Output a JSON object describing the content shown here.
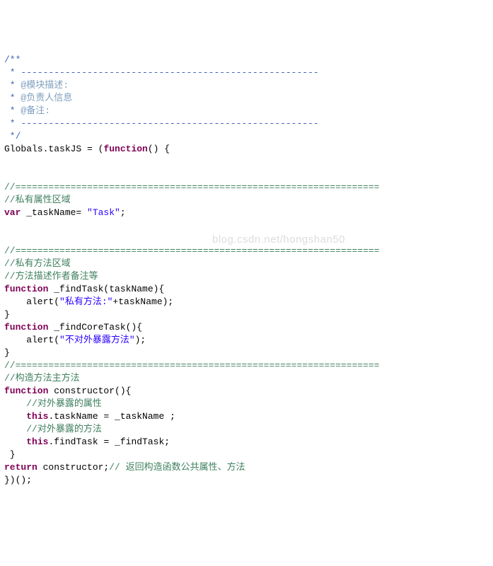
{
  "watermark": "blog.csdn.net/hongshan50",
  "lines": [
    {
      "segs": [
        {
          "t": "/**",
          "c": "c-doccomment"
        }
      ]
    },
    {
      "segs": [
        {
          "t": " * ",
          "c": "c-doccomment"
        },
        {
          "t": "------------------------------------------------------",
          "c": "c-doccomment"
        }
      ]
    },
    {
      "segs": [
        {
          "t": " * ",
          "c": "c-doccomment"
        },
        {
          "t": "@模块描述:",
          "c": "c-doctag"
        }
      ]
    },
    {
      "segs": [
        {
          "t": " * ",
          "c": "c-doccomment"
        },
        {
          "t": "@负责人信息",
          "c": "c-doctag"
        }
      ]
    },
    {
      "segs": [
        {
          "t": " * ",
          "c": "c-doccomment"
        },
        {
          "t": "@备注:",
          "c": "c-doctag"
        }
      ]
    },
    {
      "segs": [
        {
          "t": " * ",
          "c": "c-doccomment"
        },
        {
          "t": "------------------------------------------------------",
          "c": "c-doccomment"
        }
      ]
    },
    {
      "segs": [
        {
          "t": " */",
          "c": "c-doccomment"
        }
      ]
    },
    {
      "segs": [
        {
          "t": "Globals.taskJS = (",
          "c": "c-default"
        },
        {
          "t": "function",
          "c": "c-keyword"
        },
        {
          "t": "() {",
          "c": "c-default"
        }
      ]
    },
    {
      "segs": [
        {
          "t": "",
          "c": "c-default"
        }
      ]
    },
    {
      "segs": [
        {
          "t": "",
          "c": "c-default"
        }
      ]
    },
    {
      "segs": [
        {
          "t": "//==================================================================",
          "c": "c-comment"
        }
      ]
    },
    {
      "segs": [
        {
          "t": "//私有属性区域",
          "c": "c-comment"
        }
      ]
    },
    {
      "segs": [
        {
          "t": "var",
          "c": "c-keyword"
        },
        {
          "t": " _taskName= ",
          "c": "c-default"
        },
        {
          "t": "\"Task\"",
          "c": "c-string"
        },
        {
          "t": ";",
          "c": "c-default"
        }
      ]
    },
    {
      "segs": [
        {
          "t": "",
          "c": "c-default"
        }
      ]
    },
    {
      "segs": [
        {
          "t": "",
          "c": "c-default"
        }
      ]
    },
    {
      "segs": [
        {
          "t": "//==================================================================",
          "c": "c-comment"
        }
      ]
    },
    {
      "segs": [
        {
          "t": "//私有方法区域",
          "c": "c-comment"
        }
      ]
    },
    {
      "segs": [
        {
          "t": "//方法描述作者备注等",
          "c": "c-comment"
        }
      ]
    },
    {
      "segs": [
        {
          "t": "function",
          "c": "c-keyword"
        },
        {
          "t": " _findTask(taskName){",
          "c": "c-default"
        }
      ]
    },
    {
      "segs": [
        {
          "t": "    alert(",
          "c": "c-default"
        },
        {
          "t": "\"私有方法:\"",
          "c": "c-string"
        },
        {
          "t": "+taskName);",
          "c": "c-default"
        }
      ]
    },
    {
      "segs": [
        {
          "t": "}",
          "c": "c-default"
        }
      ]
    },
    {
      "segs": [
        {
          "t": "function",
          "c": "c-keyword"
        },
        {
          "t": " _findCoreTask(){",
          "c": "c-default"
        }
      ]
    },
    {
      "segs": [
        {
          "t": "    alert(",
          "c": "c-default"
        },
        {
          "t": "\"不对外暴露方法\"",
          "c": "c-string"
        },
        {
          "t": ");",
          "c": "c-default"
        }
      ]
    },
    {
      "segs": [
        {
          "t": "}",
          "c": "c-default"
        }
      ]
    },
    {
      "segs": [
        {
          "t": "//==================================================================",
          "c": "c-comment"
        }
      ]
    },
    {
      "segs": [
        {
          "t": "//构造方法主方法",
          "c": "c-comment"
        }
      ]
    },
    {
      "segs": [
        {
          "t": "function",
          "c": "c-keyword"
        },
        {
          "t": " constructor(){",
          "c": "c-default"
        }
      ]
    },
    {
      "segs": [
        {
          "t": "    ",
          "c": "c-default"
        },
        {
          "t": "//对外暴露的属性",
          "c": "c-comment"
        }
      ]
    },
    {
      "segs": [
        {
          "t": "    ",
          "c": "c-default"
        },
        {
          "t": "this",
          "c": "c-keyword"
        },
        {
          "t": ".taskName = _taskName ;",
          "c": "c-default"
        }
      ]
    },
    {
      "segs": [
        {
          "t": "    ",
          "c": "c-default"
        },
        {
          "t": "//对外暴露的方法",
          "c": "c-comment"
        }
      ]
    },
    {
      "segs": [
        {
          "t": "    ",
          "c": "c-default"
        },
        {
          "t": "this",
          "c": "c-keyword"
        },
        {
          "t": ".findTask = _findTask;",
          "c": "c-default"
        }
      ]
    },
    {
      "segs": [
        {
          "t": " }",
          "c": "c-default"
        }
      ]
    },
    {
      "segs": [
        {
          "t": "return",
          "c": "c-keyword"
        },
        {
          "t": " constructor;",
          "c": "c-default"
        },
        {
          "t": "// 返回构造函数公共属性、方法",
          "c": "c-comment"
        }
      ]
    },
    {
      "segs": [
        {
          "t": "})();",
          "c": "c-default"
        }
      ]
    }
  ]
}
